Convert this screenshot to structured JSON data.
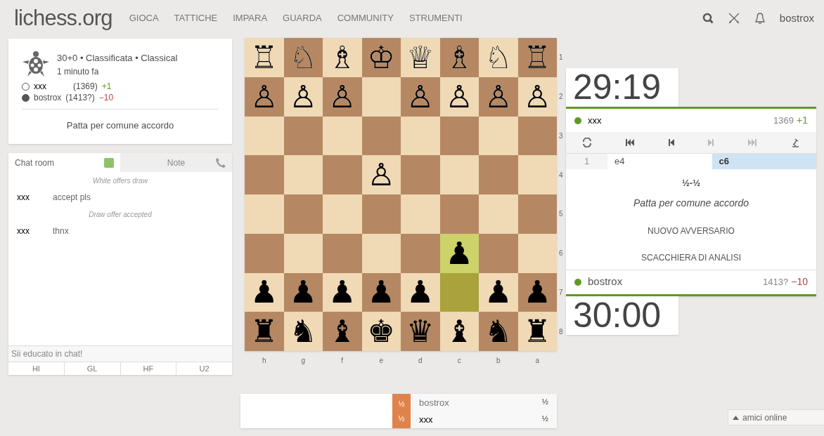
{
  "header": {
    "logo": "lichess.org",
    "nav": [
      "GIOCA",
      "TATTICHE",
      "IMPARA",
      "GUARDA",
      "COMMUNITY",
      "STRUMENTI"
    ],
    "username": "bostrox"
  },
  "game_info": {
    "title": "30+0 • Classificata • Classical",
    "time_ago": "1 minuto fa",
    "players": [
      {
        "kind": "white",
        "name": "xxx",
        "rating": "(1369)",
        "diff": "+1",
        "color": "#629924"
      },
      {
        "kind": "black",
        "name": "bostrox",
        "rating": "(1413?)",
        "diff": "−10",
        "color": "#c33f3f"
      }
    ],
    "status": "Patta per comune accordo"
  },
  "chat": {
    "tabs": [
      {
        "label": "Chat room",
        "selected": true
      },
      {
        "label": "Note",
        "selected": false
      }
    ],
    "chat_enabled": true,
    "messages": [
      {
        "kind": "system",
        "text": "White offers draw"
      },
      {
        "kind": "user",
        "user": "xxx",
        "text": "accept pls"
      },
      {
        "kind": "system",
        "text": "Draw offer accepted"
      },
      {
        "kind": "user",
        "user": "xxx",
        "text": "thnx"
      }
    ],
    "placeholder": "Sii educato in chat!",
    "presets": [
      "HI",
      "GL",
      "HF",
      "U2"
    ]
  },
  "board": {
    "ranks": [
      {
        "label": "1",
        "squares": [
          {
            "piece": "♖",
            "highlighted": false
          },
          {
            "piece": "♘",
            "highlighted": false
          },
          {
            "piece": "♗",
            "highlighted": false
          },
          {
            "piece": "♔",
            "highlighted": false
          },
          {
            "piece": "♕",
            "highlighted": false
          },
          {
            "piece": "♗",
            "highlighted": false
          },
          {
            "piece": "♘",
            "highlighted": false
          },
          {
            "piece": "♖",
            "highlighted": false
          }
        ]
      },
      {
        "label": "2",
        "squares": [
          {
            "piece": "♙",
            "highlighted": false
          },
          {
            "piece": "♙",
            "highlighted": false
          },
          {
            "piece": "♙",
            "highlighted": false
          },
          {
            "highlighted": false
          },
          {
            "piece": "♙",
            "highlighted": false
          },
          {
            "piece": "♙",
            "highlighted": false
          },
          {
            "piece": "♙",
            "highlighted": false
          },
          {
            "piece": "♙",
            "highlighted": false
          }
        ]
      },
      {
        "label": "3",
        "squares": [
          {
            "highlighted": false
          },
          {
            "highlighted": false
          },
          {
            "highlighted": false
          },
          {
            "highlighted": false
          },
          {
            "highlighted": false
          },
          {
            "highlighted": false
          },
          {
            "highlighted": false
          },
          {
            "highlighted": false
          }
        ]
      },
      {
        "label": "4",
        "squares": [
          {
            "highlighted": false
          },
          {
            "highlighted": false
          },
          {
            "highlighted": false
          },
          {
            "piece": "♙",
            "highlighted": false
          },
          {
            "highlighted": false
          },
          {
            "highlighted": false
          },
          {
            "highlighted": false
          },
          {
            "highlighted": false
          }
        ]
      },
      {
        "label": "5",
        "squares": [
          {
            "highlighted": false
          },
          {
            "highlighted": false
          },
          {
            "highlighted": false
          },
          {
            "highlighted": false
          },
          {
            "highlighted": false
          },
          {
            "highlighted": false
          },
          {
            "highlighted": false
          },
          {
            "highlighted": false
          }
        ]
      },
      {
        "label": "6",
        "squares": [
          {
            "highlighted": false
          },
          {
            "highlighted": false
          },
          {
            "highlighted": false
          },
          {
            "highlighted": false
          },
          {
            "highlighted": false
          },
          {
            "piece": "♟",
            "highlighted": true
          },
          {
            "highlighted": false
          },
          {
            "highlighted": false
          }
        ]
      },
      {
        "label": "7",
        "squares": [
          {
            "piece": "♟",
            "highlighted": false
          },
          {
            "piece": "♟",
            "highlighted": false
          },
          {
            "piece": "♟",
            "highlighted": false
          },
          {
            "piece": "♟",
            "highlighted": false
          },
          {
            "piece": "♟",
            "highlighted": false
          },
          {
            "highlighted": true
          },
          {
            "piece": "♟",
            "highlighted": false
          },
          {
            "piece": "♟",
            "highlighted": false
          }
        ]
      },
      {
        "label": "8",
        "squares": [
          {
            "piece": "♜",
            "highlighted": false
          },
          {
            "piece": "♞",
            "highlighted": false
          },
          {
            "piece": "♝",
            "highlighted": false
          },
          {
            "piece": "♚",
            "highlighted": false
          },
          {
            "piece": "♛",
            "highlighted": false
          },
          {
            "piece": "♝",
            "highlighted": false
          },
          {
            "piece": "♞",
            "highlighted": false
          },
          {
            "piece": "♜",
            "highlighted": false
          }
        ]
      }
    ],
    "files": [
      "h",
      "g",
      "f",
      "e",
      "d",
      "c",
      "b",
      "a"
    ]
  },
  "crosstable": {
    "rows": [
      {
        "left_score": "½",
        "name": "bostrox",
        "score": "½"
      },
      {
        "left_score": "½",
        "name": "xxx",
        "score": "½"
      }
    ]
  },
  "clocks": {
    "top": "29:19",
    "bottom": "30:00"
  },
  "opponent": {
    "name": "xxx",
    "rating": "1369",
    "diff": "+1",
    "color": "#629924"
  },
  "me": {
    "name": "bostrox",
    "rating": "1413?",
    "diff": "−10",
    "color": "#c33f3f"
  },
  "moves": [
    {
      "number": "1",
      "plies": [
        {
          "san": "e4",
          "selected": false
        },
        {
          "san": "c6",
          "selected": true
        }
      ]
    }
  ],
  "result": {
    "score": "½-½",
    "status": "Patta per comune accordo",
    "buttons": [
      "NUOVO AVVERSARIO",
      "SCACCHIERA DI ANALISI"
    ]
  },
  "friends": "amici online"
}
